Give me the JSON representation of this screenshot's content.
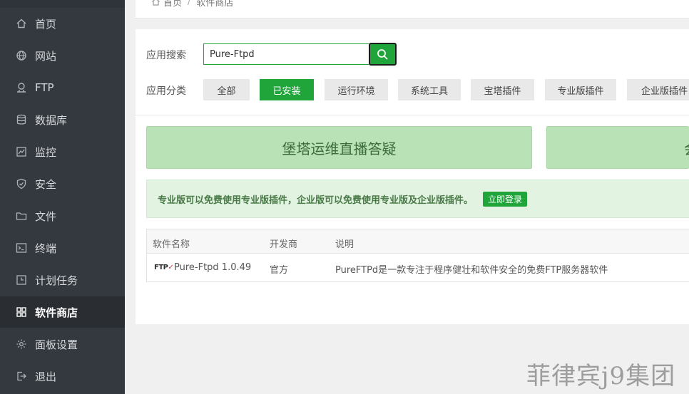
{
  "sidebar": {
    "items": [
      {
        "label": "首页",
        "icon": "home-icon"
      },
      {
        "label": "网站",
        "icon": "globe-icon"
      },
      {
        "label": "FTP",
        "icon": "ftp-icon"
      },
      {
        "label": "数据库",
        "icon": "database-icon"
      },
      {
        "label": "监控",
        "icon": "monitor-icon"
      },
      {
        "label": "安全",
        "icon": "shield-icon"
      },
      {
        "label": "文件",
        "icon": "folder-icon"
      },
      {
        "label": "终端",
        "icon": "terminal-icon"
      },
      {
        "label": "计划任务",
        "icon": "clock-icon"
      },
      {
        "label": "软件商店",
        "icon": "grid-icon",
        "active": true
      },
      {
        "label": "面板设置",
        "icon": "gear-icon"
      },
      {
        "label": "退出",
        "icon": "logout-icon"
      }
    ]
  },
  "breadcrumb": {
    "home": "首页",
    "separator": "/",
    "current": "软件商店"
  },
  "search": {
    "label": "应用搜索",
    "value": "Pure-Ftpd"
  },
  "category": {
    "label": "应用分类",
    "items": [
      "全部",
      "已安装",
      "运行环境",
      "系统工具",
      "宝塔插件",
      "专业版插件",
      "企业版插件"
    ],
    "active": "已安装"
  },
  "banners": [
    "堡塔运维直播答疑",
    "会"
  ],
  "notice": {
    "text": "专业版可以免费使用专业版插件，企业版可以免费使用专业版及企业版插件。",
    "button": "立即登录"
  },
  "table": {
    "headers": [
      "软件名称",
      "开发商",
      "说明"
    ],
    "rows": [
      {
        "logo": "FTP",
        "name": "Pure-Ftpd 1.0.49",
        "developer": "官方",
        "description": "PureFTPd是一款专注于程序健壮和软件安全的免费FTP服务器软件"
      }
    ]
  },
  "watermark": "菲律宾j9集团",
  "colors": {
    "accent": "#20a53a",
    "sidebar": "#34393f",
    "banner": "#b9e3b7",
    "notice": "#e2f4e1"
  }
}
